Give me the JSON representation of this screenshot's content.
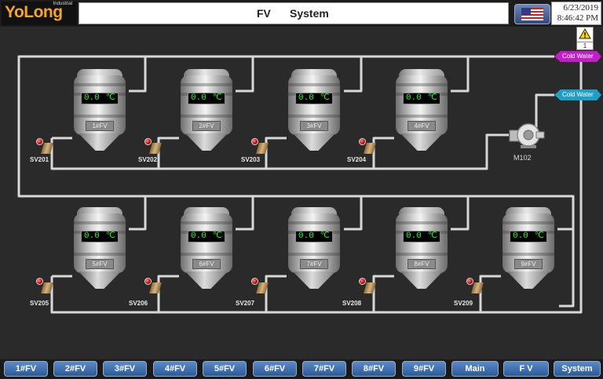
{
  "header": {
    "logo_brand": "YoLong",
    "logo_sub": "Industrial",
    "title_part1": "FV",
    "title_part2": "System",
    "date": "6/23/2019",
    "time": "8:46:42 PM",
    "language_flag": "us-flag-icon",
    "alarm_count": "1"
  },
  "tanks": [
    {
      "name": "1#FV",
      "temp": "0.0",
      "unit": "℃"
    },
    {
      "name": "2#FV",
      "temp": "0.0",
      "unit": "℃"
    },
    {
      "name": "3#FV",
      "temp": "0.0",
      "unit": "℃"
    },
    {
      "name": "4#FV",
      "temp": "0.0",
      "unit": "℃"
    },
    {
      "name": "5#FV",
      "temp": "0.0",
      "unit": "℃"
    },
    {
      "name": "6#FV",
      "temp": "0.0",
      "unit": "℃"
    },
    {
      "name": "7#FV",
      "temp": "0.0",
      "unit": "℃"
    },
    {
      "name": "8#FV",
      "temp": "0.0",
      "unit": "℃"
    },
    {
      "name": "9#FV",
      "temp": "0.0",
      "unit": "℃"
    }
  ],
  "valves": [
    "SV201",
    "SV202",
    "SV203",
    "SV204",
    "SV205",
    "SV206",
    "SV207",
    "SV208",
    "SV209"
  ],
  "cold_water_out": "Cold Water",
  "cold_water_in": "Cold Water",
  "pump_label": "M102",
  "colors": {
    "background": "#2a2a2a",
    "display_text": "#19ff19",
    "cold_water_out": "#c21ec8",
    "cold_water_in": "#1f9fc8",
    "nav_button": "#3a6ab0"
  },
  "nav": [
    "1#FV",
    "2#FV",
    "3#FV",
    "4#FV",
    "5#FV",
    "6#FV",
    "7#FV",
    "8#FV",
    "9#FV",
    "Main",
    "F V",
    "System"
  ]
}
